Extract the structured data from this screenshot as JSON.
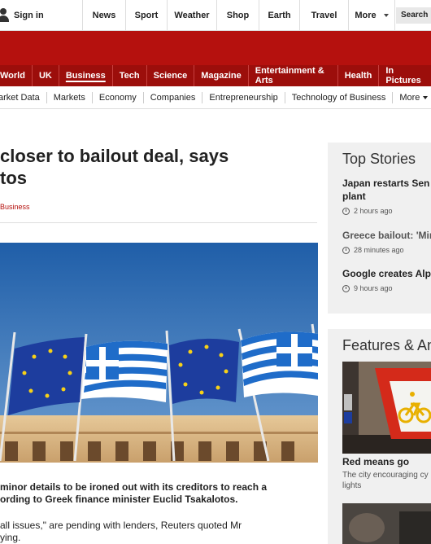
{
  "topbar": {
    "signin_label": "Sign in",
    "nav": [
      "News",
      "Sport",
      "Weather",
      "Shop",
      "Earth",
      "Travel",
      "More"
    ],
    "search_label": "Search"
  },
  "section_nav": {
    "items": [
      "World",
      "UK",
      "Business",
      "Tech",
      "Science",
      "Magazine",
      "Entertainment & Arts",
      "Health",
      "In Pictures"
    ],
    "active": "Business"
  },
  "sub_nav": {
    "items": [
      "arket Data",
      "Markets",
      "Economy",
      "Companies",
      "Entrepreneurship",
      "Technology of Business"
    ],
    "more_label": "More"
  },
  "article": {
    "headline_line1": "closer to bailout deal, says",
    "headline_line2": "tos",
    "section": "Business",
    "body_line1": "minor details to be ironed out with its creditors to reach a",
    "body_line2": "ording to Greek finance minister Euclid Tsakalotos.",
    "body2_line1": "all issues,\" are pending with lenders, Reuters quoted Mr",
    "body2_line2": "ying."
  },
  "top_stories": {
    "title": "Top Stories",
    "items": [
      {
        "title_line1": "Japan restarts Sen",
        "title_line2": "plant",
        "time": "2 hours ago"
      },
      {
        "title_line1": "Greece bailout: 'Mir",
        "title_line2": "",
        "time": "28 minutes ago"
      },
      {
        "title_line1": "Google creates Alp",
        "title_line2": "",
        "time": "9 hours ago"
      }
    ]
  },
  "features": {
    "title": "Features & An",
    "item": {
      "title": "Red means go",
      "desc_line1": "The city encouraging cy",
      "desc_line2": "lights"
    }
  },
  "colors": {
    "bbc_red": "#b5110e",
    "section_nav_red": "#9c0e0b",
    "sidebar_bg": "#f0f0f0"
  }
}
